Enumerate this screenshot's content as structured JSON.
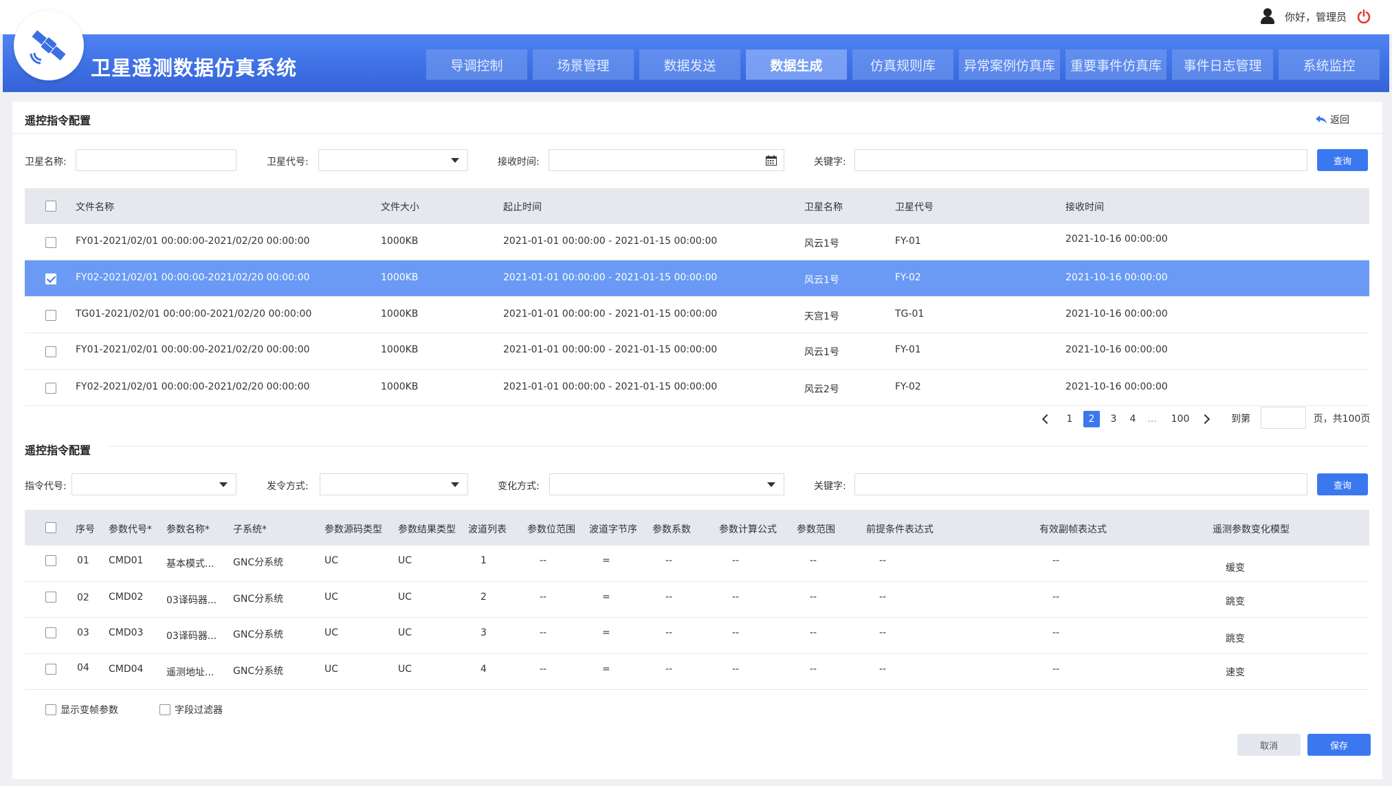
{
  "user": {
    "greeting": "你好，管理员"
  },
  "header": {
    "app_title": "卫星遥测数据仿真系统",
    "nav": [
      {
        "label": "导调控制",
        "active": false
      },
      {
        "label": "场景管理",
        "active": false
      },
      {
        "label": "数据发送",
        "active": false
      },
      {
        "label": "数据生成",
        "active": true
      },
      {
        "label": "仿真规则库",
        "active": false
      },
      {
        "label": "异常案例仿真库",
        "active": false
      },
      {
        "label": "重要事件仿真库",
        "active": false
      },
      {
        "label": "事件日志管理",
        "active": false
      },
      {
        "label": "系统监控",
        "active": false
      }
    ]
  },
  "colors": {
    "primary": "#3b78f0",
    "selected_row": "#6a9af4",
    "header_bg": "#3d6fe3",
    "table_header": "#e6e8ee"
  },
  "section1": {
    "title": "遥控指令配置",
    "back_label": "返回",
    "filters": {
      "satellite_name_label": "卫星名称:",
      "satellite_name_value": "",
      "satellite_code_label": "卫星代号:",
      "satellite_code_value": "",
      "receive_time_label": "接收时间:",
      "receive_time_value": "",
      "keyword_label": "关键字:",
      "keyword_value": "",
      "query_label": "查询"
    },
    "columns": [
      "文件名称",
      "文件大小",
      "起止时间",
      "卫星名称",
      "卫星代号",
      "接收时间"
    ],
    "rows": [
      {
        "file": "FY01-2021/02/01 00:00:00-2021/02/20 00:00:00",
        "size": "1000KB",
        "range": "2021-01-01 00:00:00 - 2021-01-15 00:00:00",
        "sat_name": "风云1号",
        "sat_code": "FY-01",
        "recv": "2021-10-16 00:00:00",
        "checked": false
      },
      {
        "file": "FY02-2021/02/01 00:00:00-2021/02/20 00:00:00",
        "size": "1000KB",
        "range": "2021-01-01 00:00:00 - 2021-01-15 00:00:00",
        "sat_name": "风云1号",
        "sat_code": "FY-02",
        "recv": "2021-10-16 00:00:00",
        "checked": true
      },
      {
        "file": "TG01-2021/02/01 00:00:00-2021/02/20 00:00:00",
        "size": "1000KB",
        "range": "2021-01-01 00:00:00 - 2021-01-15 00:00:00",
        "sat_name": "天宫1号",
        "sat_code": "TG-01",
        "recv": "2021-10-16 00:00:00",
        "checked": false
      },
      {
        "file": "FY01-2021/02/01 00:00:00-2021/02/20 00:00:00",
        "size": "1000KB",
        "range": "2021-01-01 00:00:00 - 2021-01-15 00:00:00",
        "sat_name": "风云1号",
        "sat_code": "FY-01",
        "recv": "2021-10-16 00:00:00",
        "checked": false
      },
      {
        "file": "FY02-2021/02/01 00:00:00-2021/02/20 00:00:00",
        "size": "1000KB",
        "range": "2021-01-01 00:00:00 - 2021-01-15 00:00:00",
        "sat_name": "风云2号",
        "sat_code": "FY-02",
        "recv": "2021-10-16 00:00:00",
        "checked": false
      }
    ],
    "pagination": {
      "pages": [
        "1",
        "2",
        "3",
        "4",
        "...",
        "100"
      ],
      "current": "2",
      "goto_label": "到第",
      "page_suffix": "页，共100页",
      "goto_value": ""
    }
  },
  "section2": {
    "title": "遥控指令配置",
    "filters": {
      "cmd_code_label": "指令代号:",
      "cmd_code_value": "",
      "send_mode_label": "发令方式:",
      "send_mode_value": "",
      "change_mode_label": "变化方式:",
      "change_mode_value": "",
      "keyword_label": "关键字:",
      "keyword_value": "",
      "query_label": "查询"
    },
    "columns": [
      "序号",
      "参数代号*",
      "参数名称*",
      "子系统*",
      "参数源码类型",
      "参数结果类型",
      "波道列表",
      "参数位范围",
      "波道字节序",
      "参数系数",
      "参数计算公式",
      "参数范围",
      "前提条件表达式",
      "有效副帧表达式",
      "遥测参数变化模型"
    ],
    "rows": [
      {
        "no": "01",
        "code": "CMD01",
        "name": "基本模式...",
        "sub": "GNC分系统",
        "src": "UC",
        "res": "UC",
        "ch": "1",
        "bit": "--",
        "order": "=",
        "coef": "--",
        "formula": "--",
        "range": "--",
        "pre": "--",
        "valid": "--",
        "model": "缓变"
      },
      {
        "no": "02",
        "code": "CMD02",
        "name": "03译码器...",
        "sub": "GNC分系统",
        "src": "UC",
        "res": "UC",
        "ch": "2",
        "bit": "--",
        "order": "=",
        "coef": "--",
        "formula": "--",
        "range": "--",
        "pre": "--",
        "valid": "--",
        "model": "跳变"
      },
      {
        "no": "03",
        "code": "CMD03",
        "name": "03译码器...",
        "sub": "GNC分系统",
        "src": "UC",
        "res": "UC",
        "ch": "3",
        "bit": "--",
        "order": "=",
        "coef": "--",
        "formula": "--",
        "range": "--",
        "pre": "--",
        "valid": "--",
        "model": "跳变"
      },
      {
        "no": "04",
        "code": "CMD04",
        "name": "遥测地址...",
        "sub": "GNC分系统",
        "src": "UC",
        "res": "UC",
        "ch": "4",
        "bit": "--",
        "order": "=",
        "coef": "--",
        "formula": "--",
        "range": "--",
        "pre": "--",
        "valid": "--",
        "model": "速变"
      }
    ],
    "options": {
      "show_var_frame": "显示变帧参数",
      "field_filter": "字段过滤器"
    },
    "cancel_label": "取消",
    "save_label": "保存"
  }
}
